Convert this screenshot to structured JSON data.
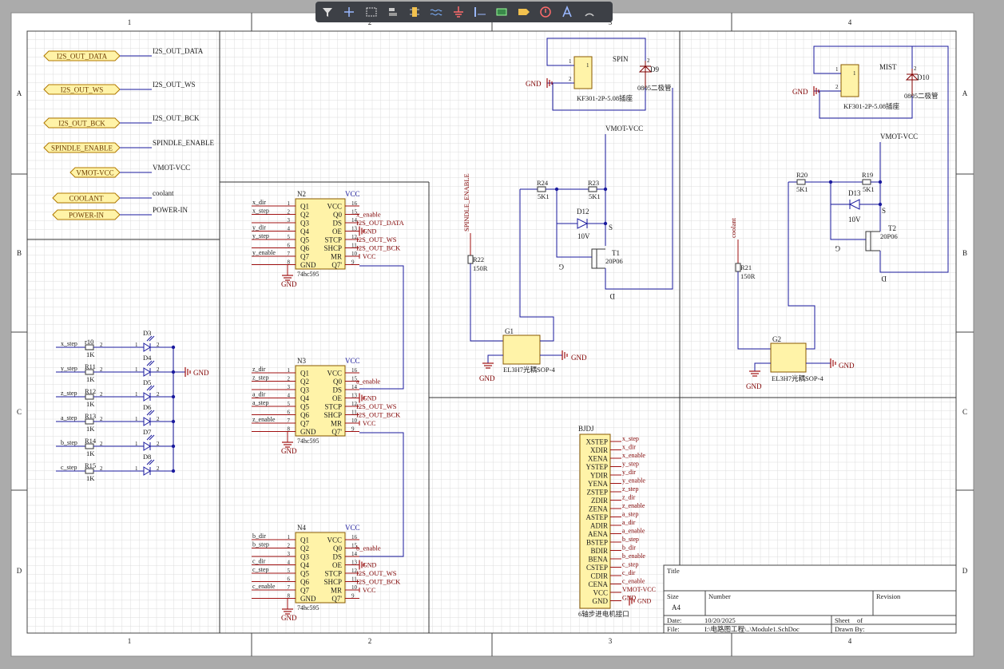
{
  "toolbar": [
    {
      "name": "filter-icon"
    },
    {
      "name": "crosshair-icon"
    },
    {
      "name": "select-box-icon"
    },
    {
      "name": "align-icon"
    },
    {
      "name": "component-icon"
    },
    {
      "name": "wire-icon"
    },
    {
      "name": "power-port-icon"
    },
    {
      "name": "bus-icon"
    },
    {
      "name": "net-label-icon"
    },
    {
      "name": "port-icon"
    },
    {
      "name": "directive-icon"
    },
    {
      "name": "text-icon"
    },
    {
      "name": "arc-icon"
    }
  ],
  "border": {
    "columns": [
      "1",
      "2",
      "3",
      "4"
    ],
    "rows": [
      "A",
      "B",
      "C",
      "D"
    ]
  },
  "ports": [
    {
      "label": "I2S_OUT_DATA",
      "net": "I2S_OUT_DATA"
    },
    {
      "label": "I2S_OUT_WS",
      "net": "I2S_OUT_WS"
    },
    {
      "label": "I2S_OUT_BCK",
      "net": "I2S_OUT_BCK"
    },
    {
      "label": "SPINDLE_ENABLE",
      "net": "SPINDLE_ENABLE"
    },
    {
      "label": "VMOT-VCC",
      "net": "VMOT-VCC"
    },
    {
      "label": "COOLANT",
      "net": "coolant"
    },
    {
      "label": "POWER-IN",
      "net": "POWER-IN"
    }
  ],
  "chip_pins": {
    "left": [
      "Q1",
      "Q2",
      "Q3",
      "Q4",
      "Q5",
      "Q6",
      "Q7",
      "GND"
    ],
    "right": [
      "VCC",
      "Q0",
      "DS",
      "OE",
      "STCP",
      "SHCP",
      "MR",
      "Q7'"
    ],
    "left_nums": [
      "1",
      "2",
      "3",
      "4",
      "5",
      "6",
      "7",
      "8"
    ],
    "right_nums": [
      "16",
      "15",
      "14",
      "13",
      "12",
      "11",
      "10",
      "9"
    ],
    "part": "74hc595"
  },
  "chips": [
    {
      "ref": "N2",
      "vcc": "VCC",
      "gnd": "GND",
      "gnd2": "GND",
      "vcc2": "VCC",
      "left_nets": [
        "x_dir",
        "x_step",
        "",
        "y_dir",
        "y_step",
        "",
        "y_enable",
        ""
      ],
      "right_nets": [
        "",
        "x_enable",
        "I2S_OUT_DATA",
        "",
        "I2S_OUT_WS",
        "I2S_OUT_BCK",
        "",
        ""
      ]
    },
    {
      "ref": "N3",
      "vcc": "VCC",
      "gnd": "GND",
      "gnd2": "GND",
      "vcc2": "VCC",
      "left_nets": [
        "z_dir",
        "z_step",
        "",
        "a_dir",
        "a_step",
        "",
        "z_enable",
        ""
      ],
      "right_nets": [
        "",
        "a_enable",
        "",
        "",
        "I2S_OUT_WS",
        "I2S_OUT_BCK",
        "",
        ""
      ]
    },
    {
      "ref": "N4",
      "vcc": "VCC",
      "gnd": "GND",
      "gnd2": "GND",
      "vcc2": "VCC",
      "left_nets": [
        "b_dir",
        "b_step",
        "",
        "c_dir",
        "c_step",
        "",
        "c_enable",
        ""
      ],
      "right_nets": [
        "",
        "b_enable",
        "",
        "",
        "I2S_OUT_WS",
        "I2S_OUT_BCK",
        "",
        ""
      ]
    }
  ],
  "leds": {
    "gnd": "GND",
    "rows": [
      {
        "net": "x_step",
        "r": "r10",
        "d": "D3",
        "val": "1K"
      },
      {
        "net": "y_step",
        "r": "R11",
        "d": "D4",
        "val": "1K"
      },
      {
        "net": "z_step",
        "r": "R12",
        "d": "D5",
        "val": "1K"
      },
      {
        "net": "a_step",
        "r": "R13",
        "d": "D6",
        "val": "1K"
      },
      {
        "net": "b_step",
        "r": "R14",
        "d": "D7",
        "val": "1K"
      },
      {
        "net": "c_step",
        "r": "R15",
        "d": "D8",
        "val": "1K"
      }
    ]
  },
  "spin": {
    "title": "SPIN",
    "conn": "KF301-2P-5.08插座",
    "diode": "D9",
    "diode_val": "0805二极管",
    "gnd": "GND",
    "vmot": "VMOT-VCC",
    "enable": "SPINDLE_ENABLE",
    "r24": "R24",
    "r24v": "5K1",
    "r23": "R23",
    "r23v": "5K1",
    "zener": "D12",
    "zener_v": "10V",
    "mos": "T1",
    "mos_v": "20P06",
    "r22": "R22",
    "r22v": "150R",
    "opto": "G1",
    "opto_v": "EL3H7光耦SOP-4",
    "gnd2": "GND",
    "gnd3": "GND",
    "s": "S",
    "g": "G",
    "d": "D"
  },
  "mist": {
    "title": "MIST",
    "conn": "KF301-2P-5.08插座",
    "diode": "D10",
    "diode_val": "0805二极管",
    "gnd": "GND",
    "vmot": "VMOT-VCC",
    "enable": "coolant",
    "r20": "R20",
    "r20v": "5K1",
    "r19": "R19",
    "r19v": "5K1",
    "zener": "D13",
    "zener_v": "10V",
    "mos": "T2",
    "mos_v": "20P06",
    "r21": "R21",
    "r21v": "150R",
    "opto": "G2",
    "opto_v": "EL3H7光耦SOP-4",
    "gnd2": "GND",
    "gnd3": "GND",
    "s": "S",
    "g": "G",
    "d": "D"
  },
  "bjdj": {
    "ref": "BJDJ",
    "desc": "6轴步进电机接口",
    "pins": [
      "XSTEP",
      "XDIR",
      "XENA",
      "YSTEP",
      "YDIR",
      "YENA",
      "ZSTEP",
      "ZDIR",
      "ZENA",
      "ASTEP",
      "ADIR",
      "AENA",
      "BSTEP",
      "BDIR",
      "BENA",
      "CSTEP",
      "CDIR",
      "CENA",
      "VCC",
      "GND"
    ],
    "nets": [
      "x_step",
      "x_dir",
      "x_enable",
      "y_step",
      "y_dir",
      "y_enable",
      "z_step",
      "z_dir",
      "z_enable",
      "a_step",
      "a_dir",
      "a_enable",
      "b_step",
      "b_dir",
      "b_enable",
      "c_step",
      "c_dir",
      "c_enable",
      "VMOT-VCC",
      "GND"
    ]
  },
  "title_block": {
    "title": "Title",
    "size_label": "Size",
    "size": "A4",
    "number_label": "Number",
    "revision_label": "Revision",
    "date_label": "Date:",
    "date": "10/20/2025",
    "sheet_label": "Sheet",
    "of_label": "of",
    "file_label": "File:",
    "file": "I:\\电路图工程\\..\\Module1.SchDoc",
    "drawn_label": "Drawn By:"
  },
  "colors": {
    "wire": "#1a1a9e",
    "part": "#a01010",
    "body": "#fff3a8",
    "sheet": "#ffffff",
    "grid": "#dcdcdc"
  }
}
